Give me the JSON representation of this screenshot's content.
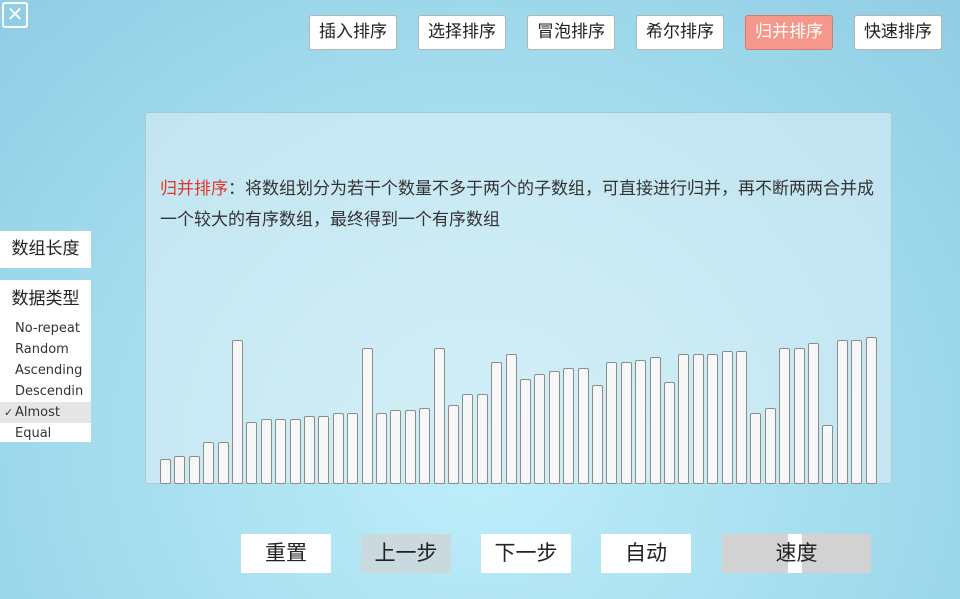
{
  "close_glyph": "✕",
  "sort_tabs": [
    {
      "label": "插入排序",
      "active": false
    },
    {
      "label": "选择排序",
      "active": false
    },
    {
      "label": "冒泡排序",
      "active": false
    },
    {
      "label": "希尔排序",
      "active": false
    },
    {
      "label": "归并排序",
      "active": true
    },
    {
      "label": "快速排序",
      "active": false
    }
  ],
  "description": {
    "title": "归并排序",
    "text": "：将数组划分为若干个数量不多于两个的子数组，可直接进行归并，再不断两两合并成一个较大的有序数组，最终得到一个有序数组"
  },
  "array_values": [
    9,
    10,
    10,
    15,
    15,
    51,
    22,
    23,
    23,
    23,
    24,
    24,
    25,
    25,
    48,
    25,
    26,
    26,
    27,
    48,
    28,
    32,
    32,
    43,
    46,
    37,
    39,
    40,
    41,
    41,
    35,
    43,
    43,
    44,
    45,
    36,
    46,
    46,
    46,
    47,
    47,
    25,
    27,
    48,
    48,
    50,
    21,
    51,
    51,
    52
  ],
  "array_max": 52,
  "left_panel": {
    "length_label": "数组长度",
    "type_label": "数据类型",
    "type_options": [
      "No-repeat",
      "Random",
      "Ascending",
      "Descendin",
      "Almost",
      "Equal"
    ],
    "selected_type": "Almost",
    "check_glyph": "✓"
  },
  "controls": {
    "reset": "重置",
    "prev": "上一步",
    "next": "下一步",
    "auto": "自动",
    "speed": "速度"
  },
  "colors": {
    "active_tab": "#f5978a",
    "title_red": "#e8332c"
  }
}
